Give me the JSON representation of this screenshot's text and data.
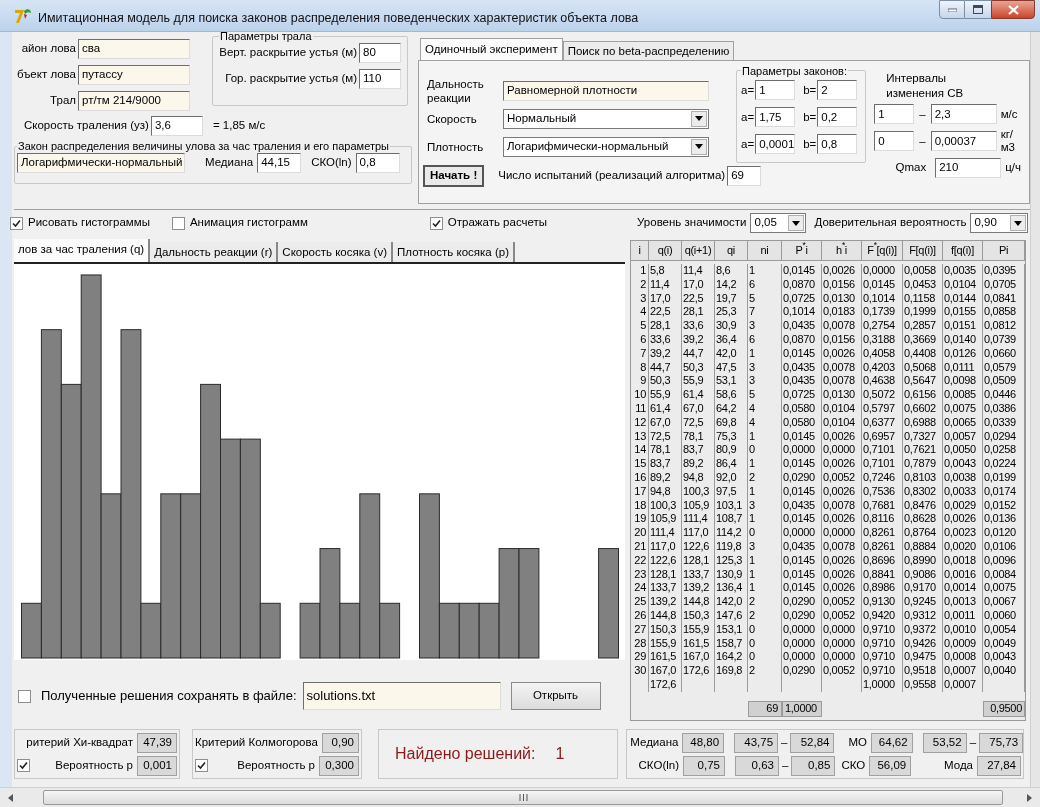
{
  "window": {
    "title": "Имитационная модель для поиска законов распределения поведенческих характеристик объекта лова"
  },
  "catch": {
    "fields": [
      {
        "label": "айон лова",
        "value": "сва"
      },
      {
        "label": "бъект лова",
        "value": "путассу"
      },
      {
        "label": "Трал",
        "value": "рт/тм 214/9000"
      }
    ],
    "speed": {
      "label": "Скорость траления (уз)",
      "value": "3,6",
      "converted": "= 1,85 м/с"
    }
  },
  "trawl_params": {
    "title": "Параметры трала",
    "fields": [
      {
        "label": "Верт. раскрытие устья (м)",
        "value": "80"
      },
      {
        "label": "Гор. раскрытие устья (м)",
        "value": "110"
      }
    ]
  },
  "catch_law": {
    "title": "Закон распределения величины улова за час траления и его параметры",
    "law": "Логарифмически-нормальный",
    "median_label": "Медиана",
    "median": "44,15",
    "sko_label": "СКО(ln)",
    "sko": "0,8"
  },
  "experiment_tabs": [
    {
      "label": "Одиночный эксперимент",
      "selected": true
    },
    {
      "label": "Поиск по beta-распределению",
      "selected": false
    }
  ],
  "experiment": {
    "laws_title": "Параметры законов:",
    "intervals_title": "Интервалы изменения СВ",
    "rows": [
      {
        "label": "Дальность реакции",
        "kind": "readonly",
        "law": "Равномерной плотности",
        "a_label": "a=",
        "a": "1",
        "b_label": "b=",
        "b": "2"
      },
      {
        "label": "Скорость",
        "kind": "select",
        "law": "Нормальный",
        "a_label": "a=",
        "a": "1,75",
        "b_label": "b=",
        "b": "0,2",
        "from": "1",
        "dash": "–",
        "to": "2,3",
        "unit": "м/с"
      },
      {
        "label": "Плотность",
        "kind": "select",
        "law": "Логарифмически-нормальный",
        "a_label": "a=",
        "a": "0,0001",
        "b_label": "b=",
        "b": "0,8",
        "from": "0",
        "dash": "–",
        "to": "0,00037",
        "unit": "кг/м3"
      }
    ],
    "qmax": {
      "label": "Qmax",
      "value": "210",
      "unit": "ц/ч"
    },
    "start_button": "Начать !",
    "trials": {
      "label": "Число испытаний (реализаций алгоритма)",
      "value": "69"
    }
  },
  "options": [
    {
      "label": "Рисовать гистограммы",
      "checked": true
    },
    {
      "label": "Анимация гистограмм",
      "checked": false
    },
    {
      "label": "Отражать расчеты",
      "checked": true
    }
  ],
  "significance": {
    "label": "Уровень значимости",
    "value": "0,05"
  },
  "confidence": {
    "label": "Доверительная вероятность",
    "value": "0,90"
  },
  "histogram_tabs": [
    {
      "label": "лов за час траления (q)",
      "selected": true
    },
    {
      "label": "Дальность реакции (r)",
      "selected": false
    },
    {
      "label": "Скорость косяка (v)",
      "selected": false
    },
    {
      "label": "Плотность косяка (p)",
      "selected": false
    }
  ],
  "table": {
    "columns": [
      "i",
      "q(i)",
      "q(i+1)",
      "qi",
      "ni",
      "P$^{*}$i",
      "h$^{*}$i",
      "F$^{*}$[q(i)]",
      "F[q(i)]",
      "f[q(i)]",
      "Pi"
    ],
    "rows": [
      {
        "cells": [
          "1",
          "5,8",
          "11,4",
          "8,6",
          "1",
          "0,0145",
          "0,0026",
          "0,0000",
          "0,0058",
          "0,0035",
          "0,0395"
        ]
      },
      {
        "cells": [
          "2",
          "11,4",
          "17,0",
          "14,2",
          "6",
          "0,0870",
          "0,0156",
          "0,0145",
          "0,0453",
          "0,0104",
          "0,0705"
        ]
      },
      {
        "cells": [
          "3",
          "17,0",
          "22,5",
          "19,7",
          "5",
          "0,0725",
          "0,0130",
          "0,1014",
          "0,1158",
          "0,0144",
          "0,0841"
        ]
      },
      {
        "cells": [
          "4",
          "22,5",
          "28,1",
          "25,3",
          "7",
          "0,1014",
          "0,0183",
          "0,1739",
          "0,1999",
          "0,0155",
          "0,0858"
        ]
      },
      {
        "cells": [
          "5",
          "28,1",
          "33,6",
          "30,9",
          "3",
          "0,0435",
          "0,0078",
          "0,2754",
          "0,2857",
          "0,0151",
          "0,0812"
        ]
      },
      {
        "cells": [
          "6",
          "33,6",
          "39,2",
          "36,4",
          "6",
          "0,0870",
          "0,0156",
          "0,3188",
          "0,3669",
          "0,0140",
          "0,0739"
        ]
      },
      {
        "cells": [
          "7",
          "39,2",
          "44,7",
          "42,0",
          "1",
          "0,0145",
          "0,0026",
          "0,4058",
          "0,4408",
          "0,0126",
          "0,0660"
        ]
      },
      {
        "cells": [
          "8",
          "44,7",
          "50,3",
          "47,5",
          "3",
          "0,0435",
          "0,0078",
          "0,4203",
          "0,5068",
          "0,0111",
          "0,0579"
        ]
      },
      {
        "cells": [
          "9",
          "50,3",
          "55,9",
          "53,1",
          "3",
          "0,0435",
          "0,0078",
          "0,4638",
          "0,5647",
          "0,0098",
          "0,0509"
        ]
      },
      {
        "cells": [
          "10",
          "55,9",
          "61,4",
          "58,6",
          "5",
          "0,0725",
          "0,0130",
          "0,5072",
          "0,6156",
          "0,0085",
          "0,0446"
        ]
      },
      {
        "cells": [
          "11",
          "61,4",
          "67,0",
          "64,2",
          "4",
          "0,0580",
          "0,0104",
          "0,5797",
          "0,6602",
          "0,0075",
          "0,0386"
        ]
      },
      {
        "cells": [
          "12",
          "67,0",
          "72,5",
          "69,8",
          "4",
          "0,0580",
          "0,0104",
          "0,6377",
          "0,6988",
          "0,0065",
          "0,0339"
        ]
      },
      {
        "cells": [
          "13",
          "72,5",
          "78,1",
          "75,3",
          "1",
          "0,0145",
          "0,0026",
          "0,6957",
          "0,7327",
          "0,0057",
          "0,0294"
        ]
      },
      {
        "cells": [
          "14",
          "78,1",
          "83,7",
          "80,9",
          "0",
          "0,0000",
          "0,0000",
          "0,7101",
          "0,7621",
          "0,0050",
          "0,0258"
        ]
      },
      {
        "cells": [
          "15",
          "83,7",
          "89,2",
          "86,4",
          "1",
          "0,0145",
          "0,0026",
          "0,7101",
          "0,7879",
          "0,0043",
          "0,0224"
        ]
      },
      {
        "cells": [
          "16",
          "89,2",
          "94,8",
          "92,0",
          "2",
          "0,0290",
          "0,0052",
          "0,7246",
          "0,8103",
          "0,0038",
          "0,0199"
        ]
      },
      {
        "cells": [
          "17",
          "94,8",
          "100,3",
          "97,5",
          "1",
          "0,0145",
          "0,0026",
          "0,7536",
          "0,8302",
          "0,0033",
          "0,0174"
        ]
      },
      {
        "cells": [
          "18",
          "100,3",
          "105,9",
          "103,1",
          "3",
          "0,0435",
          "0,0078",
          "0,7681",
          "0,8476",
          "0,0029",
          "0,0152"
        ]
      },
      {
        "cells": [
          "19",
          "105,9",
          "111,4",
          "108,7",
          "1",
          "0,0145",
          "0,0026",
          "0,8116",
          "0,8628",
          "0,0026",
          "0,0136"
        ]
      },
      {
        "cells": [
          "20",
          "111,4",
          "117,0",
          "114,2",
          "0",
          "0,0000",
          "0,0000",
          "0,8261",
          "0,8764",
          "0,0023",
          "0,0120"
        ]
      },
      {
        "cells": [
          "21",
          "117,0",
          "122,6",
          "119,8",
          "3",
          "0,0435",
          "0,0078",
          "0,8261",
          "0,8884",
          "0,0020",
          "0,0106"
        ]
      },
      {
        "cells": [
          "22",
          "122,6",
          "128,1",
          "125,3",
          "1",
          "0,0145",
          "0,0026",
          "0,8696",
          "0,8990",
          "0,0018",
          "0,0096"
        ]
      },
      {
        "cells": [
          "23",
          "128,1",
          "133,7",
          "130,9",
          "1",
          "0,0145",
          "0,0026",
          "0,8841",
          "0,9086",
          "0,0016",
          "0,0084"
        ]
      },
      {
        "cells": [
          "24",
          "133,7",
          "139,2",
          "136,4",
          "1",
          "0,0145",
          "0,0026",
          "0,8986",
          "0,9170",
          "0,0014",
          "0,0075"
        ]
      },
      {
        "cells": [
          "25",
          "139,2",
          "144,8",
          "142,0",
          "2",
          "0,0290",
          "0,0052",
          "0,9130",
          "0,9245",
          "0,0013",
          "0,0067"
        ]
      },
      {
        "cells": [
          "26",
          "144,8",
          "150,3",
          "147,6",
          "2",
          "0,0290",
          "0,0052",
          "0,9420",
          "0,9312",
          "0,0011",
          "0,0060"
        ]
      },
      {
        "cells": [
          "27",
          "150,3",
          "155,9",
          "153,1",
          "0",
          "0,0000",
          "0,0000",
          "0,9710",
          "0,9372",
          "0,0010",
          "0,0054"
        ]
      },
      {
        "cells": [
          "28",
          "155,9",
          "161,5",
          "158,7",
          "0",
          "0,0000",
          "0,0000",
          "0,9710",
          "0,9426",
          "0,0009",
          "0,0049"
        ]
      },
      {
        "cells": [
          "29",
          "161,5",
          "167,0",
          "164,2",
          "0",
          "0,0000",
          "0,0000",
          "0,9710",
          "0,9475",
          "0,0008",
          "0,0043"
        ]
      },
      {
        "cells": [
          "30",
          "167,0",
          "172,6",
          "169,8",
          "2",
          "0,0290",
          "0,0052",
          "0,9710",
          "0,9518",
          "0,0007",
          "0,0040"
        ]
      }
    ],
    "last_bound": {
      "q_i": "172,6",
      "F_star": "1,0000",
      "F": "0,9558",
      "f": "0,0007"
    },
    "totals": {
      "ni": "69",
      "P_star": "1,0000",
      "Pi": "0,9500"
    }
  },
  "save": {
    "label": "Полученные решения сохранять в файле:",
    "checked": false,
    "file": "solutions.txt",
    "button": "Открыть"
  },
  "chi_square": {
    "label": "ритерий Хи-квадрат",
    "value": "47,39",
    "p_label": "Вероятность р",
    "p": "0,001",
    "checked": true
  },
  "kolmogorov": {
    "label": "Критерий Колмогорова",
    "value": "0,90",
    "p_label": "Вероятность р",
    "p": "0,300",
    "checked": true
  },
  "found": {
    "label": "Найдено решений:",
    "value": "1"
  },
  "stats": {
    "median": {
      "label": "Медиана",
      "value": "48,80",
      "low": "43,75",
      "dash": "–",
      "high": "52,84"
    },
    "sko_ln": {
      "label": "СКО(ln)",
      "value": "0,75",
      "low": "0,63",
      "dash": "–",
      "high": "0,85"
    },
    "mo": {
      "label": "МО",
      "value": "64,62",
      "low": "53,52",
      "dash": "–",
      "high": "75,73"
    },
    "sko": {
      "label": "СКО",
      "value": "56,09"
    },
    "mode": {
      "label": "Мода",
      "value": "27,84"
    }
  }
}
